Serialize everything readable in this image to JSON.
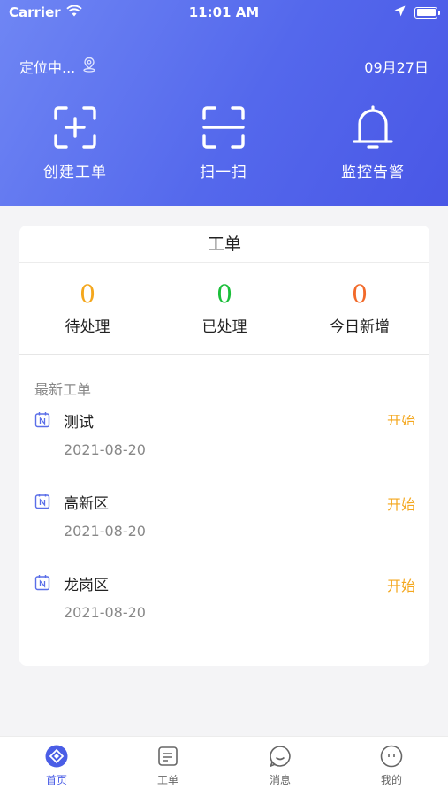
{
  "status_bar": {
    "carrier": "Carrier",
    "time": "11:01 AM"
  },
  "header": {
    "location_text": "定位中...",
    "date": "09月27日",
    "actions": [
      {
        "label": "创建工单",
        "icon": "scan-add-icon"
      },
      {
        "label": "扫一扫",
        "icon": "scan-icon"
      },
      {
        "label": "监控告警",
        "icon": "bell-icon"
      }
    ]
  },
  "card": {
    "title": "工单",
    "stats": [
      {
        "value": "0",
        "label": "待处理",
        "color": "#f4a71d"
      },
      {
        "value": "0",
        "label": "已处理",
        "color": "#1bbf3a"
      },
      {
        "value": "0",
        "label": "今日新增",
        "color": "#f26a2a"
      }
    ],
    "latest_label": "最新工单",
    "orders": [
      {
        "name": "测试",
        "date": "2021-08-20",
        "action": "开始"
      },
      {
        "name": "高新区",
        "date": "2021-08-20",
        "action": "开始"
      },
      {
        "name": "龙岗区",
        "date": "2021-08-20",
        "action": "开始"
      }
    ]
  },
  "tabbar": {
    "tabs": [
      {
        "label": "首页",
        "icon": "home-icon",
        "active": true
      },
      {
        "label": "工单",
        "icon": "document-icon",
        "active": false
      },
      {
        "label": "消息",
        "icon": "message-icon",
        "active": false
      },
      {
        "label": "我的",
        "icon": "profile-icon",
        "active": false
      }
    ]
  },
  "colors": {
    "accent": "#4a5de6",
    "header_start": "#6f86f4",
    "header_end": "#4957e6",
    "action_orange": "#f4a71d"
  }
}
